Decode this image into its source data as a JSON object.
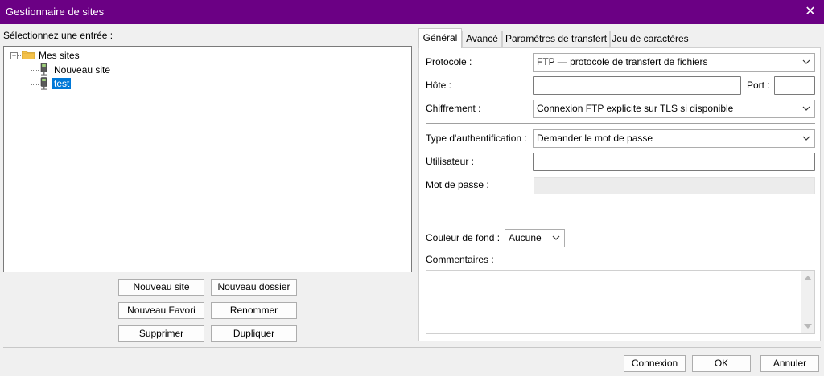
{
  "window": {
    "title": "Gestionnaire de sites",
    "close_glyph": "✕"
  },
  "left": {
    "select_label": "Sélectionnez une entrée :",
    "tree": {
      "root": {
        "label": "Mes sites",
        "icon": "folder-icon",
        "expander": "−"
      },
      "children": [
        {
          "label": "Nouveau site",
          "icon": "server-icon"
        },
        {
          "label": "test",
          "icon": "server-icon",
          "selected": true
        }
      ]
    },
    "buttons": {
      "new_site": "Nouveau site",
      "new_folder": "Nouveau dossier",
      "new_bookmark": "Nouveau Favori",
      "rename": "Renommer",
      "delete": "Supprimer",
      "duplicate": "Dupliquer"
    }
  },
  "tabs": [
    {
      "label": "Général",
      "active": true
    },
    {
      "label": "Avancé"
    },
    {
      "label": "Paramètres de transfert"
    },
    {
      "label": "Jeu de caractères"
    }
  ],
  "general": {
    "protocol_label": "Protocole :",
    "protocol_value": "FTP — protocole de transfert de fichiers",
    "host_label": "Hôte :",
    "host_value": "",
    "port_label": "Port :",
    "port_value": "",
    "encryption_label": "Chiffrement :",
    "encryption_value": "Connexion FTP explicite sur TLS si disponible",
    "auth_label": "Type d'authentification :",
    "auth_value": "Demander le mot de passe",
    "user_label": "Utilisateur :",
    "user_value": "",
    "password_label": "Mot de passe :",
    "bgcolor_label": "Couleur de fond :",
    "bgcolor_value": "Aucune",
    "comments_label": "Commentaires :",
    "comments_value": ""
  },
  "footer": {
    "connect": "Connexion",
    "ok": "OK",
    "cancel": "Annuler"
  },
  "colors": {
    "titlebar": "#6b0084",
    "selection": "#0078d7",
    "folder": "#f3c14a"
  }
}
